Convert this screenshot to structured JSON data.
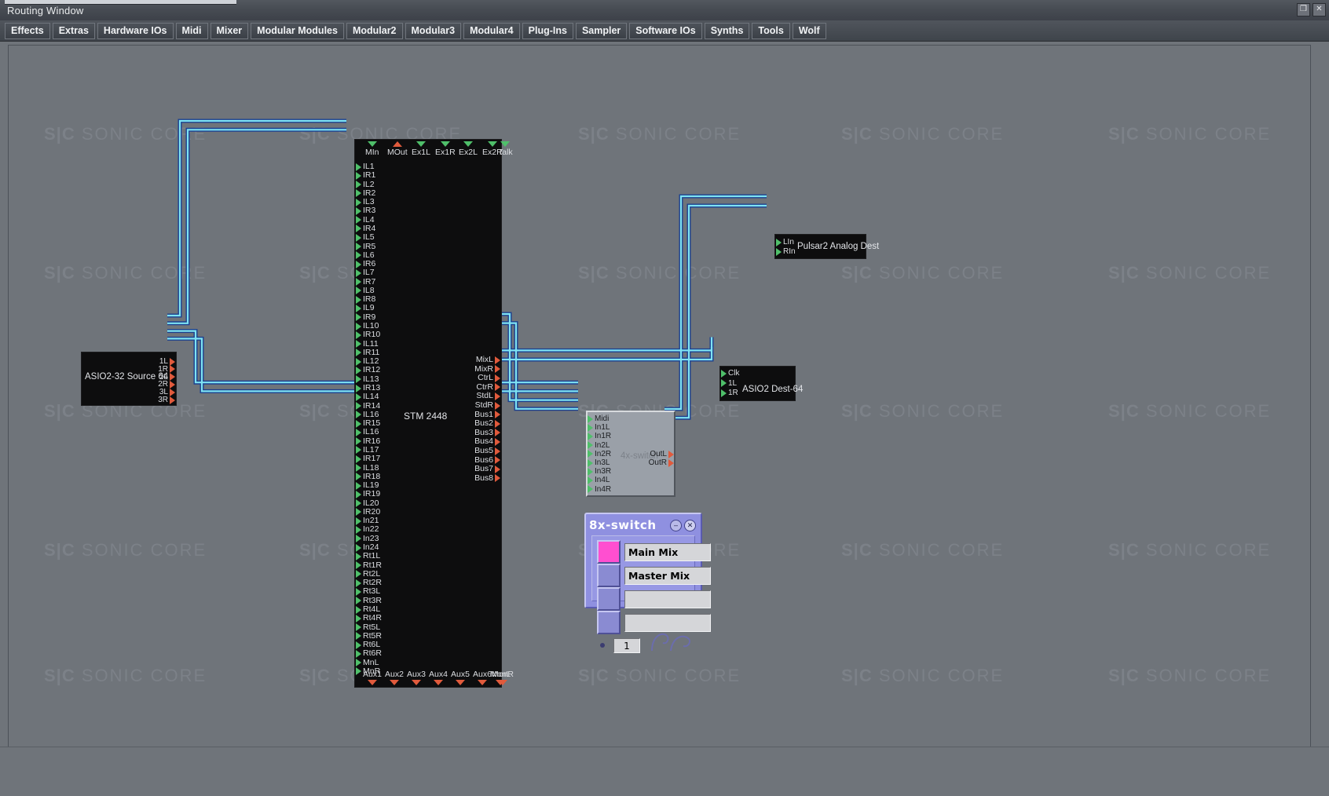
{
  "window": {
    "title": "Routing Window",
    "buttons": [
      {
        "name": "restore",
        "glyph": "❐"
      },
      {
        "name": "close",
        "glyph": "✕"
      }
    ]
  },
  "menubar": {
    "items": [
      "Effects",
      "Extras",
      "Hardware IOs",
      "Midi",
      "Mixer",
      "Modular Modules",
      "Modular2",
      "Modular3",
      "Modular4",
      "Plug-Ins",
      "Sampler",
      "Software IOs",
      "Synths",
      "Tools",
      "Wolf"
    ]
  },
  "canvas": {
    "watermark_text": "SONIC CORE",
    "watermark_mark": "S|C"
  },
  "modules": {
    "stm2448": {
      "title": "STM 2448",
      "top_ports": [
        "MIn",
        "MOut",
        "Ex1L",
        "Ex1R",
        "Ex2L",
        "Ex2R",
        "Talk"
      ],
      "inputs": [
        "IL1",
        "IR1",
        "IL2",
        "IR2",
        "IL3",
        "IR3",
        "IL4",
        "IR4",
        "IL5",
        "IR5",
        "IL6",
        "IR6",
        "IL7",
        "IR7",
        "IL8",
        "IR8",
        "IL9",
        "IR9",
        "IL10",
        "IR10",
        "IL11",
        "IR11",
        "IL12",
        "IR12",
        "IL13",
        "IR13",
        "IL14",
        "IR14",
        "IL16",
        "IR15",
        "IL16",
        "IR16",
        "IL17",
        "IR17",
        "IL18",
        "IR18",
        "IL19",
        "IR19",
        "IL20",
        "IR20",
        "In21",
        "In22",
        "In23",
        "In24",
        "Rt1L",
        "Rt1R",
        "Rt2L",
        "Rt2R",
        "Rt3L",
        "Rt3R",
        "Rt4L",
        "Rt4R",
        "Rt5L",
        "Rt5R",
        "Rt6L",
        "Rt6R",
        "MnL",
        "MnR"
      ],
      "outputs": [
        "MixL",
        "MixR",
        "CtrL",
        "CtrR",
        "StdL",
        "StdR",
        "Bus1",
        "Bus2",
        "Bus3",
        "Bus4",
        "Bus5",
        "Bus6",
        "Bus7",
        "Bus8"
      ],
      "bottom_ports": [
        "Aux1",
        "Aux2",
        "Aux3",
        "Aux4",
        "Aux5",
        "Aux6",
        "MonL",
        "MonR"
      ]
    },
    "asio_source": {
      "title": "ASIO2-32 Source 64",
      "outputs": [
        "1L",
        "1R",
        "2L",
        "2R",
        "3L",
        "3R"
      ]
    },
    "asio_dest": {
      "title": "ASIO2 Dest-64",
      "inputs": [
        "Clk",
        "1L",
        "1R"
      ]
    },
    "pulsar_dest": {
      "title": "Pulsar2 Analog Dest",
      "inputs": [
        "LIn",
        "RIn"
      ]
    },
    "switch4x": {
      "title": "4x-switch",
      "inputs": [
        "Midi",
        "In1L",
        "In1R",
        "In2L",
        "In2R",
        "In3L",
        "In3R",
        "In4L",
        "In4R"
      ],
      "outputs": [
        "OutL",
        "OutR"
      ]
    }
  },
  "panel_8x": {
    "title": "8x-switch",
    "buttons": [
      {
        "name": "minimize",
        "glyph": "–"
      },
      {
        "name": "close",
        "glyph": "✕"
      }
    ],
    "rows": [
      {
        "state": "on",
        "label": "Main Mix"
      },
      {
        "state": "off",
        "label": "Master Mix"
      },
      {
        "state": "off",
        "label": ""
      },
      {
        "state": "off",
        "label": ""
      }
    ],
    "number_value": "1",
    "accent_on_color": "#ff4fd0",
    "accent_off_color": "#8a8bd2",
    "panel_color": "#8f90e0"
  },
  "wire_color": "#7fe3f2",
  "wire_shadow_color": "#1b3f8f"
}
